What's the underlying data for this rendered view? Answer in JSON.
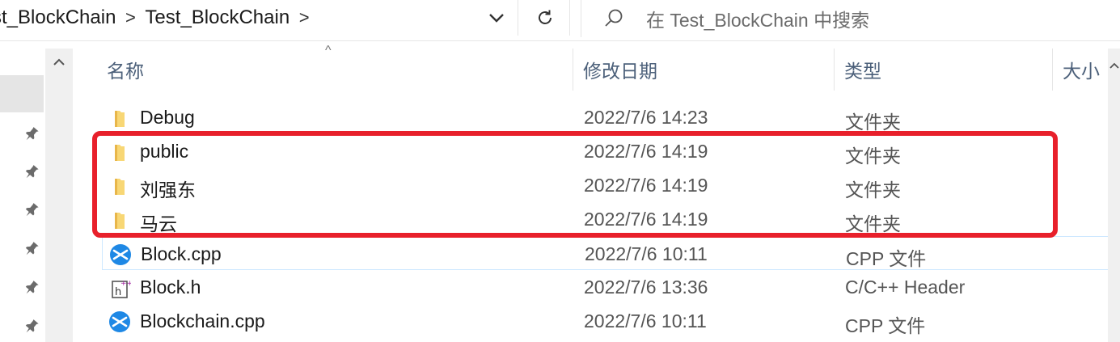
{
  "address_bar": {
    "breadcrumbs": [
      "st_BlockChain",
      "Test_BlockChain"
    ],
    "separator": ">"
  },
  "search": {
    "placeholder": "在 Test_BlockChain 中搜索"
  },
  "columns": {
    "name": "名称",
    "date": "修改日期",
    "type": "类型",
    "size": "大小"
  },
  "files": [
    {
      "name": "Debug",
      "date": "2022/7/6 14:23",
      "type": "文件夹",
      "icon": "folder-icon"
    },
    {
      "name": "public",
      "date": "2022/7/6 14:19",
      "type": "文件夹",
      "icon": "folder-icon"
    },
    {
      "name": "刘强东",
      "date": "2022/7/6 14:19",
      "type": "文件夹",
      "icon": "folder-icon"
    },
    {
      "name": "马云",
      "date": "2022/7/6 14:19",
      "type": "文件夹",
      "icon": "folder-icon"
    },
    {
      "name": "Block.cpp",
      "date": "2022/7/6 10:11",
      "type": "CPP 文件",
      "icon": "cpp-file-icon"
    },
    {
      "name": "Block.h",
      "date": "2022/7/6 13:36",
      "type": "C/C++ Header",
      "icon": "header-file-icon"
    },
    {
      "name": "Blockchain.cpp",
      "date": "2022/7/6 10:11",
      "type": "CPP 文件",
      "icon": "cpp-file-icon"
    }
  ],
  "colors": {
    "annotation": "#e8202b",
    "folder": "#f8d775",
    "header_text": "#4c607a"
  }
}
